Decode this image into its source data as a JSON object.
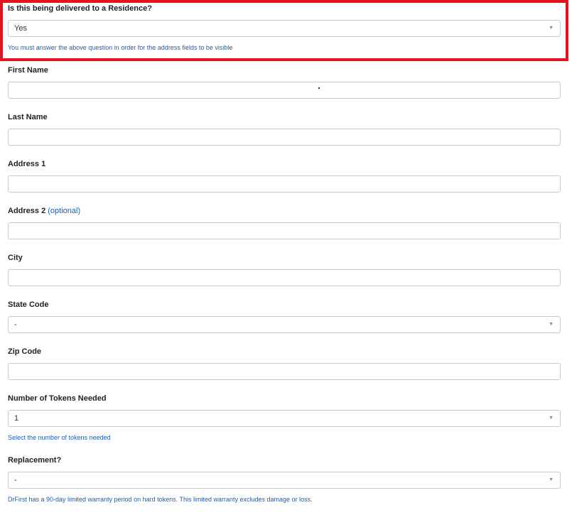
{
  "residence": {
    "label": "Is this being delivered to a Residence?",
    "value": "Yes",
    "caret_icon": "▼",
    "hint": "You must answer the above question in order for the address fields to be visible"
  },
  "first_name": {
    "label": "First Name",
    "value": ""
  },
  "last_name": {
    "label": "Last Name",
    "value": ""
  },
  "address1": {
    "label": "Address 1",
    "value": ""
  },
  "address2": {
    "label": "Address 2",
    "optional": "(optional)",
    "value": ""
  },
  "city": {
    "label": "City",
    "value": ""
  },
  "state": {
    "label": "State Code",
    "value": "-",
    "caret_icon": "▼"
  },
  "zip": {
    "label": "Zip Code",
    "value": ""
  },
  "tokens": {
    "label": "Number of Tokens Needed",
    "value": "1",
    "caret_icon": "▼",
    "hint": "Select the number of tokens needed"
  },
  "replacement": {
    "label": "Replacement?",
    "value": "-",
    "caret_icon": "▼",
    "hint": "DrFirst has a 90-day limited warranty period on hard tokens. This limited warranty excludes damage or loss."
  },
  "colors": {
    "highlight_border": "#e3141f",
    "hint_text": "#1a5fb4",
    "field_border": "#c8c8c8"
  }
}
